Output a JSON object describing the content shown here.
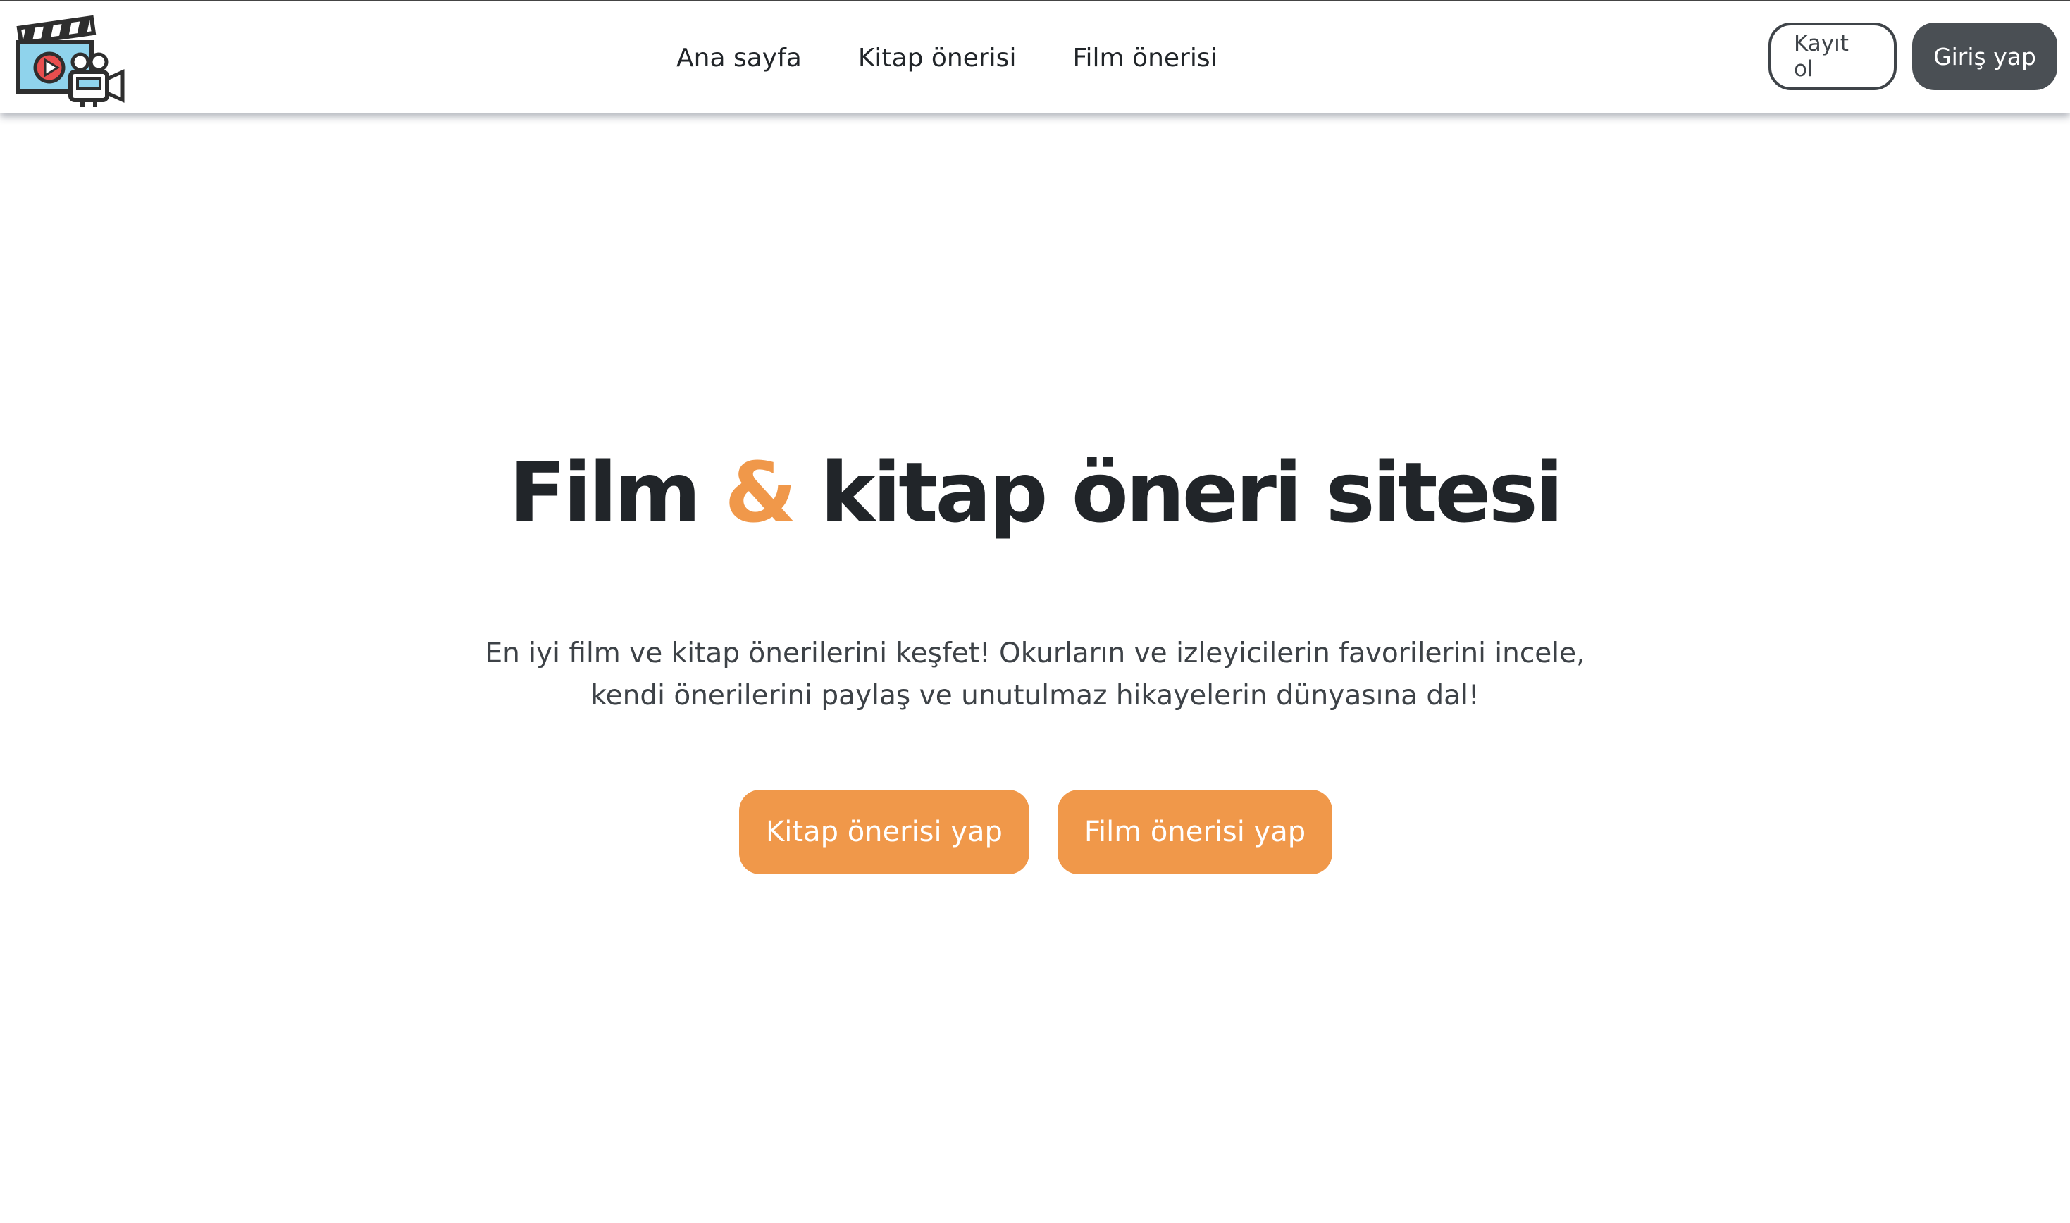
{
  "nav": {
    "logo_icon": "clapperboard-camera-icon",
    "links": [
      {
        "label": "Ana sayfa"
      },
      {
        "label": "Kitap önerisi"
      },
      {
        "label": "Film önerisi"
      }
    ],
    "register_label": "Kayıt ol",
    "login_label": "Giriş yap"
  },
  "hero": {
    "title_part1": "Film",
    "title_amp": "&",
    "title_part2": "kitap öneri sitesi",
    "description_line1": "En iyi film ve kitap önerilerini keşfet! Okurların ve izleyicilerin favorilerini incele,",
    "description_line2": "kendi önerilerini paylaş ve unutulmaz hikayelerin dünyasına dal!",
    "cta_book_label": "Kitap önerisi yap",
    "cta_film_label": "Film önerisi yap"
  },
  "colors": {
    "accent": "#f0984a",
    "dark": "#212529",
    "button_dark": "#4a4f54"
  }
}
